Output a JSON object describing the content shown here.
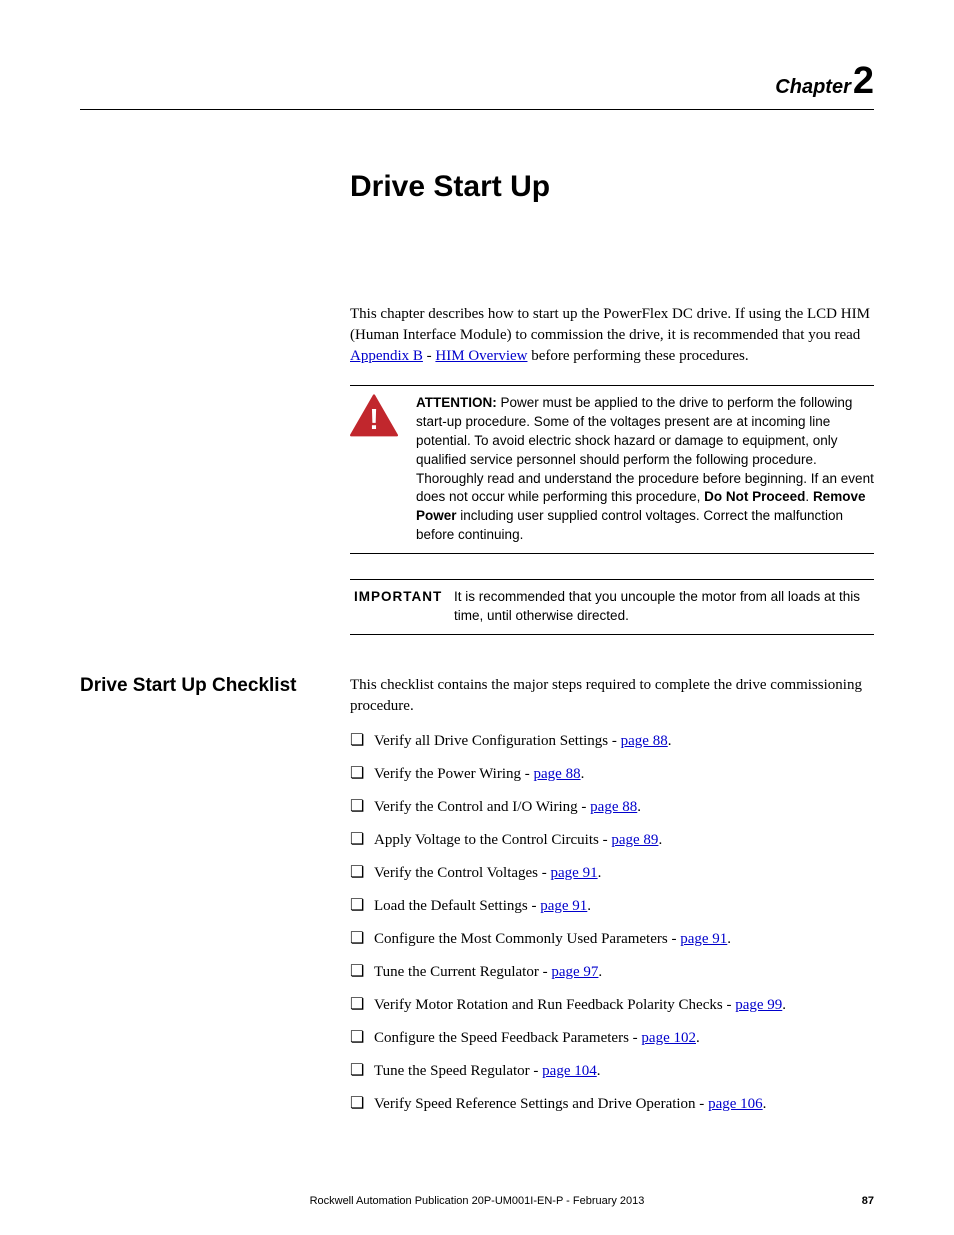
{
  "chapter_label": "Chapter",
  "chapter_number": "2",
  "title": "Drive Start Up",
  "intro": {
    "before_link1": "This chapter describes how to start up the PowerFlex DC drive. If using the LCD HIM (Human Interface Module) to commission the drive, it is recommended that you read ",
    "link1": "Appendix B",
    "mid": " - ",
    "link2": "HIM Overview",
    "after_link2": " before performing these procedures."
  },
  "attention": {
    "label": "ATTENTION:",
    "text_before_bold1": " Power must be applied to the drive to perform the following start-up procedure. Some of the voltages present are at incoming line potential. To avoid electric shock hazard or damage to equipment, only qualified service personnel should perform the following procedure. Thoroughly read and understand the procedure before beginning. If an event does not occur while performing this procedure, ",
    "bold1": "Do Not Proceed",
    "mid1": ". ",
    "bold2": "Remove Power",
    "after_bold2": " including user supplied control voltages. Correct the malfunction before continuing."
  },
  "important": {
    "label": "IMPORTANT",
    "text": "It is recommended that you uncouple the motor from all loads at this time, until otherwise directed."
  },
  "sidebar_title": "Drive Start Up Checklist",
  "checklist_intro": "This checklist contains the major steps required to complete the drive commissioning procedure.",
  "checklist": [
    {
      "text": "Verify all Drive Configuration Settings - ",
      "link": "page 88",
      "suffix": "."
    },
    {
      "text": "Verify the Power Wiring - ",
      "link": "page 88",
      "suffix": "."
    },
    {
      "text": "Verify the Control and I/O Wiring - ",
      "link": "page 88",
      "suffix": "."
    },
    {
      "text": "Apply Voltage to the Control Circuits - ",
      "link": "page 89",
      "suffix": "."
    },
    {
      "text": "Verify the Control Voltages - ",
      "link": "page 91",
      "suffix": "."
    },
    {
      "text": "Load the Default Settings - ",
      "link": "page 91",
      "suffix": "."
    },
    {
      "text": "Configure the Most Commonly Used Parameters - ",
      "link": "page 91",
      "suffix": "."
    },
    {
      "text": "Tune the Current Regulator - ",
      "link": "page 97",
      "suffix": "."
    },
    {
      "text": "Verify Motor Rotation and Run Feedback Polarity Checks - ",
      "link": "page 99",
      "suffix": "."
    },
    {
      "text": "Configure the Speed Feedback Parameters - ",
      "link": "page 102",
      "suffix": "."
    },
    {
      "text": "Tune the Speed Regulator - ",
      "link": "page 104",
      "suffix": "."
    },
    {
      "text": "Verify Speed Reference Settings and Drive Operation - ",
      "link": "page 106",
      "suffix": "."
    }
  ],
  "footer": {
    "center": "Rockwell Automation Publication 20P-UM001I-EN-P - February 2013",
    "page": "87"
  }
}
